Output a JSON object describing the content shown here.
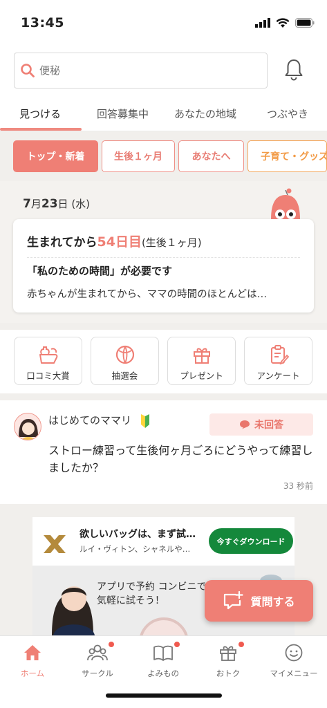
{
  "status_bar": {
    "time": "13:45"
  },
  "search": {
    "placeholder": "便秘"
  },
  "tabs": [
    {
      "label": "見つける",
      "active": true
    },
    {
      "label": "回答募集中"
    },
    {
      "label": "あなたの地域"
    },
    {
      "label": "つぶやき"
    }
  ],
  "chips": [
    {
      "label": "トップ・新着",
      "active": true
    },
    {
      "label": "生後１ヶ月"
    },
    {
      "label": "あなたへ"
    },
    {
      "label": "子育て・グッズ"
    }
  ],
  "date": {
    "month": "7",
    "month_suffix": "月",
    "day": "23",
    "day_suffix": "日",
    "weekday": "(水)"
  },
  "baby_card": {
    "prefix": "生まれてから",
    "days": "54日目",
    "age": "(生後１ヶ月)",
    "headline": "「私のための時間」が必要です",
    "body": "赤ちゃんが生まれてから、ママの時間のほとんどは…"
  },
  "features": [
    {
      "label": "口コミ大賞",
      "icon": "bottle-icon"
    },
    {
      "label": "抽選会",
      "icon": "lottery-icon"
    },
    {
      "label": "プレゼント",
      "icon": "gift-icon"
    },
    {
      "label": "アンケート",
      "icon": "survey-icon"
    }
  ],
  "question": {
    "user": "はじめてのママリ",
    "status": "未回答",
    "text": "ストロー練習って生後何ヶ月ごろにどうやって練習しましたか？",
    "time": "33 秒前"
  },
  "ad": {
    "title": "欲しいバッグは、まず試…",
    "subtitle": "ルイ・ヴィトン、シャネルや…",
    "button": "今すぐダウンロード",
    "copy_line1": "アプリで予約 コンビニで",
    "copy_line2": "気軽に試そう！"
  },
  "fab": {
    "label": "質問する"
  },
  "bottom_nav": [
    {
      "label": "ホーム",
      "active": true,
      "icon": "home-icon"
    },
    {
      "label": "サークル",
      "badge": true,
      "icon": "circle-icon"
    },
    {
      "label": "よみもの",
      "badge": true,
      "icon": "book-icon"
    },
    {
      "label": "おトク",
      "badge": true,
      "icon": "gift-icon"
    },
    {
      "label": "マイメニュー",
      "icon": "smiley-icon"
    }
  ],
  "colors": {
    "accent": "#ef7f75",
    "orange": "#f29b47",
    "ad_button": "#14883b"
  }
}
